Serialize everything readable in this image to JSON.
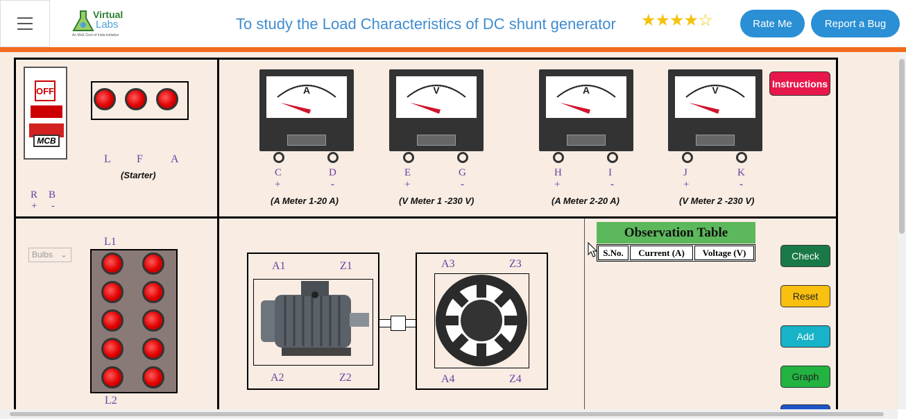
{
  "header": {
    "logo_line1": "Virtual",
    "logo_line2": "Labs",
    "logo_tagline": "An MoE Govt of India Initiative",
    "title": "To study the Load Characteristics of DC shunt generator",
    "rating_stars": "★★★★☆",
    "rate_label": "Rate Me",
    "bug_label": "Report a Bug"
  },
  "colors": {
    "accent": "#2a8fd4",
    "orange_bar": "#f26a1b",
    "background": "#f8ece3",
    "obs_header": "#5cb85c"
  },
  "mcb": {
    "off_label": "OFF",
    "mcb_label": "MCB",
    "r_label": "R",
    "b_label": "B",
    "plus": "+",
    "minus": "-"
  },
  "starter": {
    "l": "L",
    "f": "F",
    "a": "A",
    "caption": "(Starter)"
  },
  "meters": [
    {
      "letter": "A",
      "t1": "C",
      "t2": "D",
      "caption": "(A Meter 1-20 A)"
    },
    {
      "letter": "V",
      "t1": "E",
      "t2": "G",
      "caption": "(V Meter 1 -230 V)"
    },
    {
      "letter": "A",
      "t1": "H",
      "t2": "I",
      "caption": "(A Meter 2-20 A)"
    },
    {
      "letter": "V",
      "t1": "J",
      "t2": "K",
      "caption": "(V Meter 2 -230 V)"
    }
  ],
  "signs": {
    "plus": "+",
    "minus": "-"
  },
  "instructions_label": "Instructions",
  "load": {
    "select_value": "Bulbs",
    "top_label": "L1",
    "bottom_label": "L2"
  },
  "motor": {
    "a1": "A1",
    "z1": "Z1",
    "a2": "A2",
    "z2": "Z2"
  },
  "generator": {
    "a3": "A3",
    "z3": "Z3",
    "a4": "A4",
    "z4": "Z4"
  },
  "observation": {
    "title": "Observation Table",
    "headers": [
      "S.No.",
      "Current (A)",
      "Voltage (V)"
    ]
  },
  "buttons": {
    "check": "Check",
    "reset": "Reset",
    "add": "Add",
    "graph": "Graph"
  }
}
